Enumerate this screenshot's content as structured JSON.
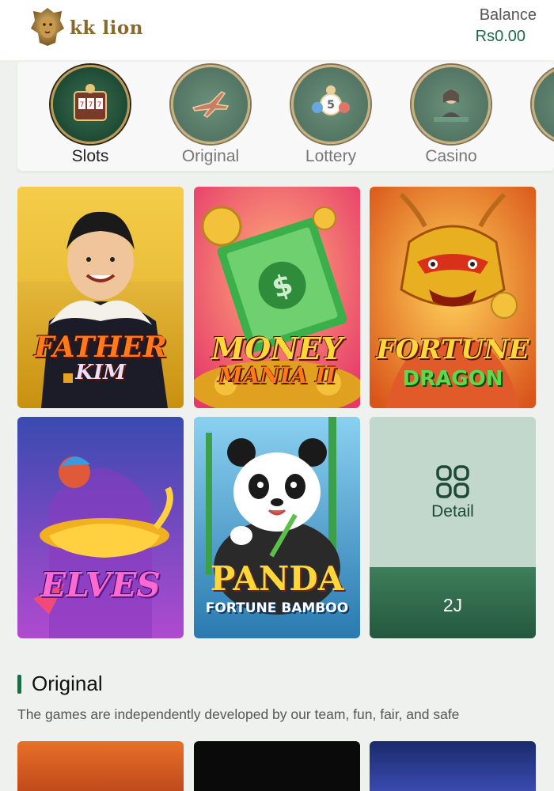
{
  "header": {
    "brand": "kk lion",
    "balance_label": "Balance",
    "balance_value": "Rs0.00",
    "logo_icon": "lion-head-icon"
  },
  "categories": [
    {
      "label": "Slots",
      "icon": "slot-machine-icon",
      "active": true
    },
    {
      "label": "Original",
      "icon": "airplane-icon",
      "active": false
    },
    {
      "label": "Lottery",
      "icon": "lottery-balls-icon",
      "active": false
    },
    {
      "label": "Casino",
      "icon": "dealer-icon",
      "active": false
    }
  ],
  "games": [
    {
      "title_line1": "FATHER",
      "title_line2": "KIM"
    },
    {
      "title_line1": "MONEY",
      "title_line2": "MANIA II"
    },
    {
      "title_line1": "FORTUNE",
      "title_line2": "DRAGON"
    },
    {
      "title_line1": "ELVES",
      "title_line2": ""
    },
    {
      "title_line1": "PANDA",
      "title_line2": "FORTUNE BAMBOO"
    }
  ],
  "detail_tile": {
    "label": "Detail",
    "code": "2J",
    "icon": "grid-apps-icon"
  },
  "section": {
    "title": "Original",
    "description": "The games are independently developed by our team, fun, fair, and safe"
  },
  "colors": {
    "accent": "#1d6a46",
    "background": "#eef1ee"
  }
}
